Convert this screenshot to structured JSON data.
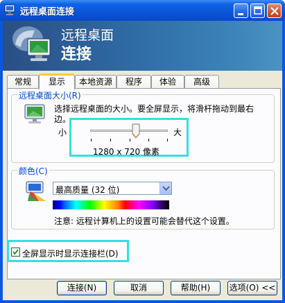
{
  "window": {
    "title": "远程桌面连接",
    "controls": {
      "minimize": "minimize",
      "maximize": "maximize",
      "close": "close"
    }
  },
  "banner": {
    "line1": "远程桌面",
    "line2": "连接"
  },
  "tabs": [
    {
      "label": "常规",
      "active": false
    },
    {
      "label": "显示",
      "active": true
    },
    {
      "label": "本地资源",
      "active": false
    },
    {
      "label": "程序",
      "active": false
    },
    {
      "label": "体验",
      "active": false
    },
    {
      "label": "高级",
      "active": false
    }
  ],
  "size_group": {
    "label": "远程桌面大小(R)",
    "description_line1": "选择远程桌面的大小。要全屏显示，将滑杆拖动到最右",
    "description_line2": "边。",
    "slider_min_label": "小",
    "slider_max_label": "大",
    "resolution": "1280 x 720 像素"
  },
  "color_group": {
    "label": "颜色(C)",
    "selected": "最高质量 (32 位)",
    "note": "注意: 远程计算机上的设置可能会替代这个设置。"
  },
  "fullscreen_checkbox": {
    "label": "全屏显示时显示连接栏(D)",
    "checked": true
  },
  "buttons": {
    "connect": "连接(N)",
    "cancel": "取消",
    "help": "帮助(H)",
    "options": "选项(O) <<"
  },
  "colors": {
    "titlebar": "#0a58e0",
    "highlight": "#33e0e0",
    "group_label": "#0046d5"
  }
}
